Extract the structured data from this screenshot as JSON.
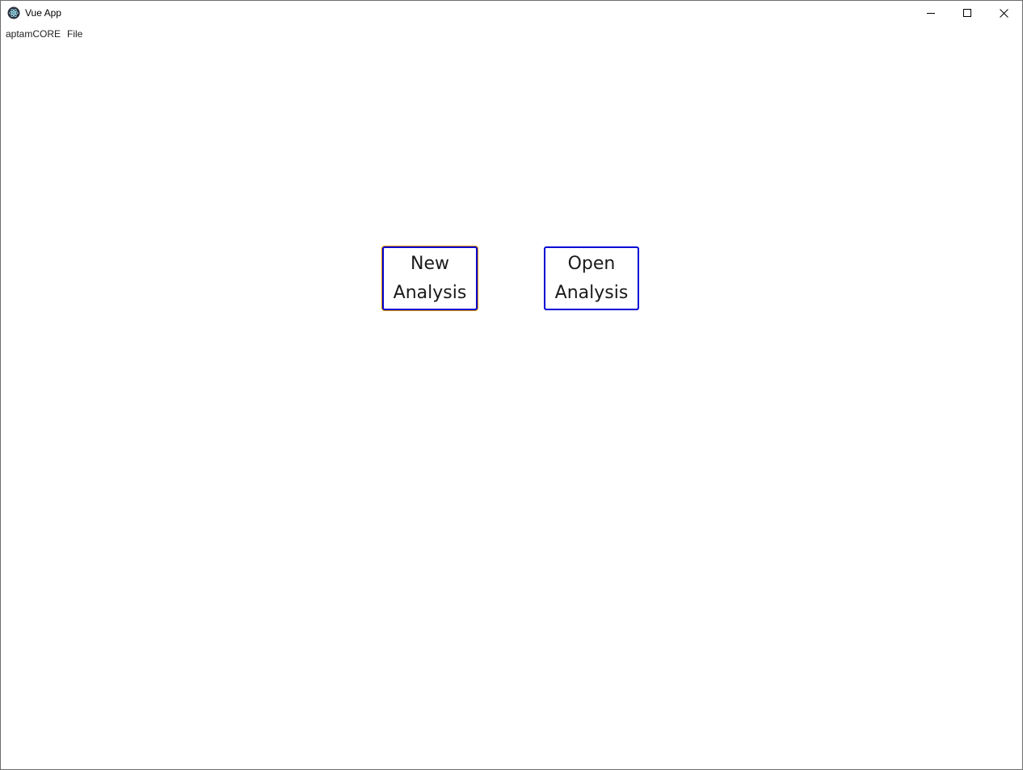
{
  "window": {
    "title": "Vue App",
    "icon": "electron-atom-icon"
  },
  "menubar": {
    "items": [
      {
        "label": "aptamCORE"
      },
      {
        "label": "File"
      }
    ]
  },
  "actions": {
    "new_analysis": {
      "line1": "New",
      "line2": "Analysis"
    },
    "open_analysis": {
      "line1": "Open",
      "line2": "Analysis"
    }
  },
  "colors": {
    "button_border": "#0000d4",
    "focus_ring": "#e59700",
    "background": "#ffffff"
  }
}
